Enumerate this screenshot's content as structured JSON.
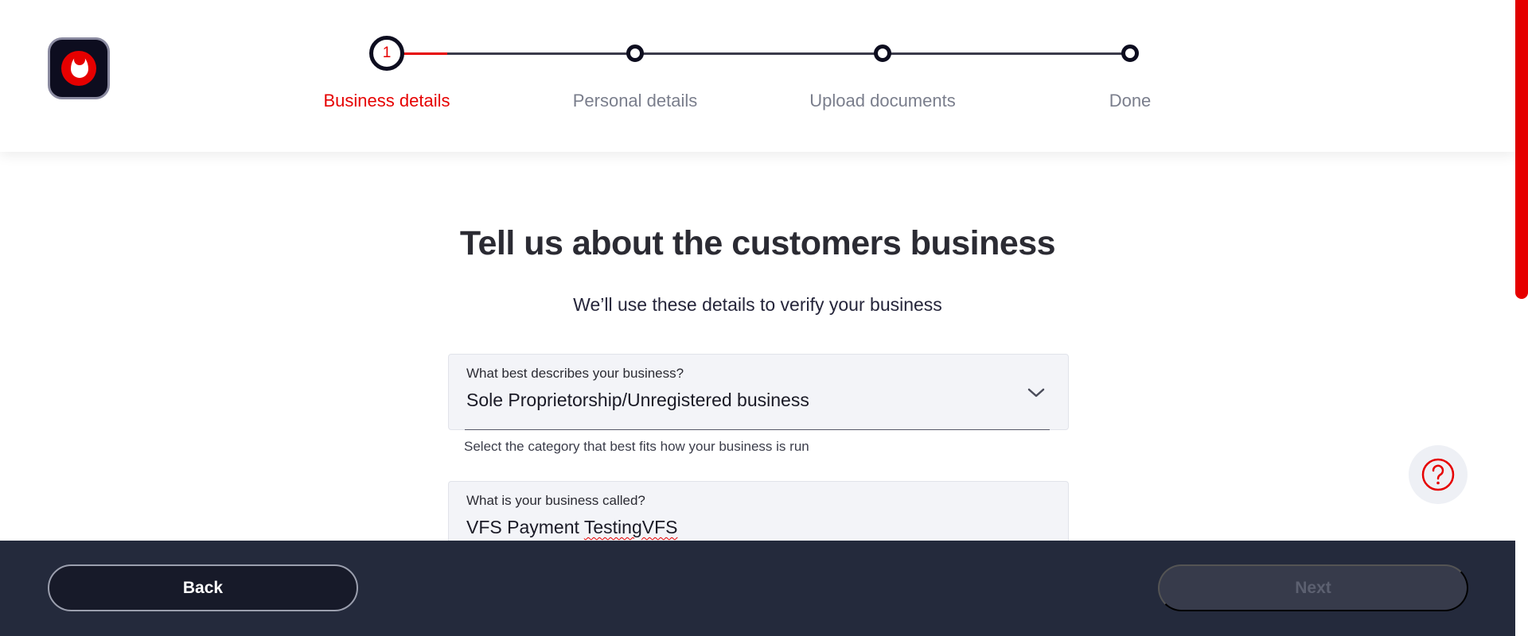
{
  "stepper": {
    "current_number": "1",
    "steps": [
      {
        "label": "Business details"
      },
      {
        "label": "Personal details"
      },
      {
        "label": "Upload documents"
      },
      {
        "label": "Done"
      }
    ]
  },
  "main": {
    "title": "Tell us about the customers business",
    "subtitle": "We’ll use these details to verify your business",
    "business_type": {
      "label": "What best describes your business?",
      "value": "Sole Proprietorship/Unregistered business",
      "helper": "Select the category that best fits how your business is run"
    },
    "business_name": {
      "label": "What is your business called?",
      "value_plain": "VFS Payment ",
      "value_misspelled": "TestingVFS"
    }
  },
  "footer": {
    "back_label": "Back",
    "next_label": "Next"
  },
  "colors": {
    "brand_red": "#e60000",
    "footer_bg": "#242a3c",
    "dark_navy": "#0d0d1f"
  },
  "icons": {
    "logo": "vodafone-logo-icon",
    "dropdown": "chevron-down-icon",
    "help": "help-question-icon"
  }
}
